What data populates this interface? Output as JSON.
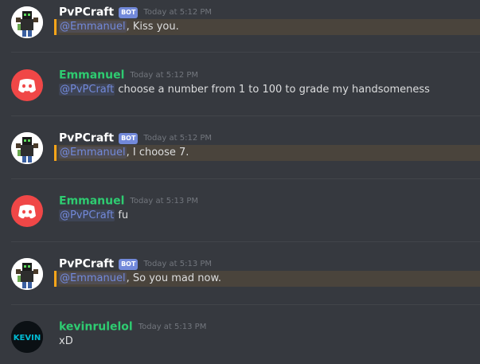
{
  "messages": [
    {
      "author": "PvPCraft",
      "bot_tag": "BOT",
      "timestamp": "Today at 5:12 PM",
      "mention": "@Emmanuel",
      "text": ", Kiss you."
    },
    {
      "author": "Emmanuel",
      "timestamp": "Today at 5:12 PM",
      "mention": "@PvPCraft",
      "text": " choose a number from 1 to 100 to grade my handsomeness"
    },
    {
      "author": "PvPCraft",
      "bot_tag": "BOT",
      "timestamp": "Today at 5:12 PM",
      "mention": "@Emmanuel",
      "text": ", I choose 7."
    },
    {
      "author": "Emmanuel",
      "timestamp": "Today at 5:13 PM",
      "mention": "@PvPCraft",
      "text": " fu"
    },
    {
      "author": "PvPCraft",
      "bot_tag": "BOT",
      "timestamp": "Today at 5:13 PM",
      "mention": "@Emmanuel",
      "text": ", So you mad now."
    },
    {
      "author": "kevinrulelol",
      "timestamp": "Today at 5:13 PM",
      "text": "xD",
      "avatar_text": "KEVIN"
    }
  ],
  "colors": {
    "background": "#36393f",
    "mention": "#7289da",
    "highlight_border": "#faa61a",
    "discord_red": "#f04747",
    "username_green": "#2ecc71"
  }
}
